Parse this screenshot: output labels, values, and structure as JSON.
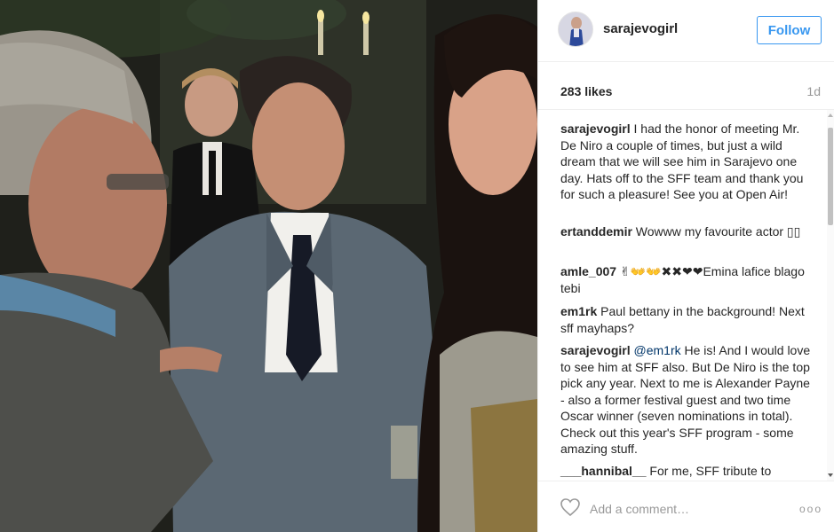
{
  "post": {
    "username": "sarajevogirl",
    "follow_label": "Follow",
    "likes": "283 likes",
    "age": "1d"
  },
  "comments": [
    {
      "author": "sarajevogirl",
      "text": " I had the honor of meeting Mr. De Niro a couple of times, but just a wild dream that we will see him in Sarajevo one day. Hats off to the SFF team and thank you for such a pleasure! See you at Open Air!"
    },
    {
      "author": "ertanddemir",
      "text": " Wowww my favourite actor ▯▯"
    },
    {
      "author": "amle_007",
      "text": " ✌👐👐✖✖❤❤Emina lafice blago tebi"
    },
    {
      "author": "em1rk",
      "text": " Paul bettany in the background! Next sff mayhaps?"
    },
    {
      "author": "sarajevogirl",
      "mention": "@em1rk",
      "text": " He is! And I would love to see him at SFF also. But De Niro is the top pick any year. Next to me is Alexander Payne - also a former festival guest and two time Oscar winner (seven nominations in total). Check out this year's SFF program - some amazing stuff."
    },
    {
      "author": "___hannibal__",
      "text": " For me, SFF tribute to"
    }
  ],
  "footer": {
    "comment_placeholder": "Add a comment…",
    "more_label": "ooo",
    "heart_icon": "heart-outline-icon"
  }
}
